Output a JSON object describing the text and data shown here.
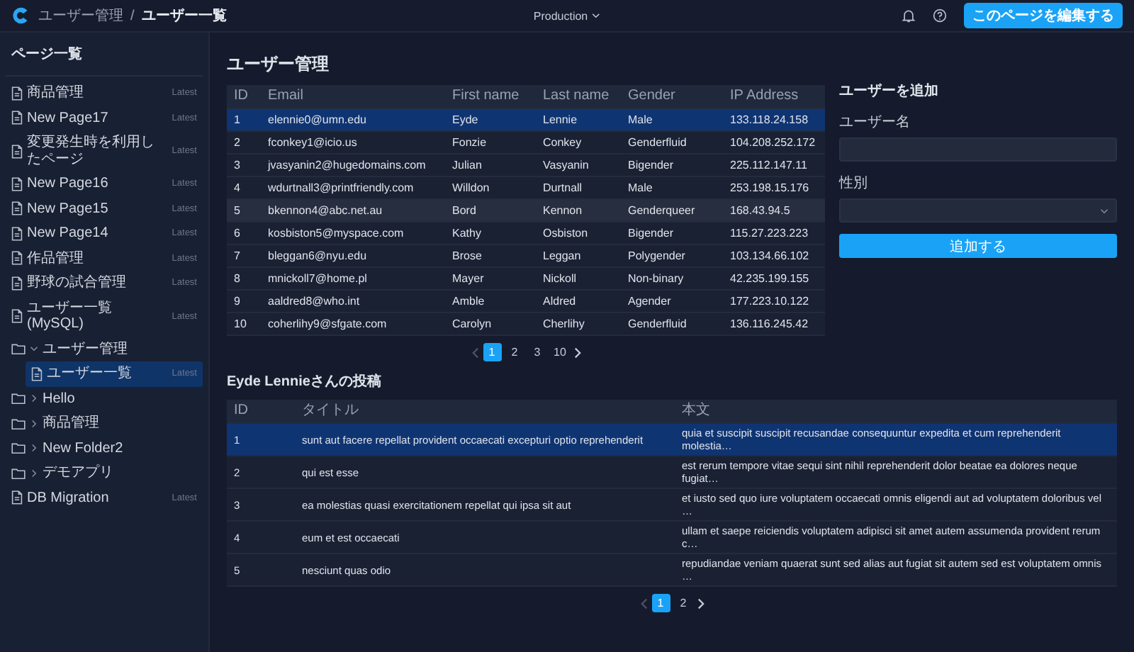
{
  "topbar": {
    "breadcrumb": [
      "ユーザー管理",
      "ユーザー一覧"
    ],
    "separator": "/",
    "environment": "Production",
    "edit_button": "このページを編集する"
  },
  "sidebar": {
    "title": "ページ一覧",
    "items": [
      {
        "kind": "page",
        "label": "商品管理",
        "badge": "Latest",
        "selected": false
      },
      {
        "kind": "page",
        "label": "New Page17",
        "badge": "Latest",
        "selected": false
      },
      {
        "kind": "page",
        "label": "変更発生時を利用したページ",
        "badge": "Latest",
        "selected": false
      },
      {
        "kind": "page",
        "label": "New Page16",
        "badge": "Latest",
        "selected": false
      },
      {
        "kind": "page",
        "label": "New Page15",
        "badge": "Latest",
        "selected": false
      },
      {
        "kind": "page",
        "label": "New Page14",
        "badge": "Latest",
        "selected": false
      },
      {
        "kind": "page",
        "label": "作品管理",
        "badge": "Latest",
        "selected": false
      },
      {
        "kind": "page",
        "label": "野球の試合管理",
        "badge": "Latest",
        "selected": false
      },
      {
        "kind": "page",
        "label": "ユーザー一覧(MySQL)",
        "badge": "Latest",
        "selected": false
      },
      {
        "kind": "folder",
        "label": "ユーザー管理",
        "expanded": true,
        "children": [
          {
            "kind": "page",
            "label": "ユーザー一覧",
            "badge": "Latest",
            "selected": true
          }
        ]
      },
      {
        "kind": "folder",
        "label": "Hello",
        "expanded": false
      },
      {
        "kind": "folder",
        "label": "商品管理",
        "expanded": false
      },
      {
        "kind": "folder",
        "label": "New Folder2",
        "expanded": false
      },
      {
        "kind": "folder",
        "label": "デモアプリ",
        "expanded": false
      },
      {
        "kind": "page",
        "label": "DB Migration",
        "badge": "Latest",
        "selected": false
      }
    ]
  },
  "users": {
    "title": "ユーザー管理",
    "table": {
      "columns": [
        "ID",
        "Email",
        "First name",
        "Last name",
        "Gender",
        "IP Address"
      ],
      "rows": [
        {
          "cells": [
            "1",
            "elennie0@umn.edu",
            "Eyde",
            "Lennie",
            "Male",
            "133.118.24.158"
          ],
          "selected": true,
          "hovered": false
        },
        {
          "cells": [
            "2",
            "fconkey1@icio.us",
            "Fonzie",
            "Conkey",
            "Genderfluid",
            "104.208.252.172"
          ],
          "selected": false,
          "hovered": false
        },
        {
          "cells": [
            "3",
            "jvasyanin2@hugedomains.com",
            "Julian",
            "Vasyanin",
            "Bigender",
            "225.112.147.11"
          ],
          "selected": false,
          "hovered": false
        },
        {
          "cells": [
            "4",
            "wdurtnall3@printfriendly.com",
            "Willdon",
            "Durtnall",
            "Male",
            "253.198.15.176"
          ],
          "selected": false,
          "hovered": false
        },
        {
          "cells": [
            "5",
            "bkennon4@abc.net.au",
            "Bord",
            "Kennon",
            "Genderqueer",
            "168.43.94.5"
          ],
          "selected": false,
          "hovered": true
        },
        {
          "cells": [
            "6",
            "kosbiston5@myspace.com",
            "Kathy",
            "Osbiston",
            "Bigender",
            "115.27.223.223"
          ],
          "selected": false,
          "hovered": false
        },
        {
          "cells": [
            "7",
            "bleggan6@nyu.edu",
            "Brose",
            "Leggan",
            "Polygender",
            "103.134.66.102"
          ],
          "selected": false,
          "hovered": false
        },
        {
          "cells": [
            "8",
            "mnickoll7@home.pl",
            "Mayer",
            "Nickoll",
            "Non-binary",
            "42.235.199.155"
          ],
          "selected": false,
          "hovered": false
        },
        {
          "cells": [
            "9",
            "aaldred8@who.int",
            "Amble",
            "Aldred",
            "Agender",
            "177.223.10.122"
          ],
          "selected": false,
          "hovered": false
        },
        {
          "cells": [
            "10",
            "coherlihy9@sfgate.com",
            "Carolyn",
            "Cherlihy",
            "Genderfluid",
            "136.116.245.42"
          ],
          "selected": false,
          "hovered": false
        }
      ]
    },
    "pagination": {
      "prev_disabled": true,
      "pages": [
        {
          "label": "1",
          "selected": true
        },
        {
          "label": "2",
          "selected": false
        },
        {
          "label": "3",
          "selected": false
        },
        {
          "label": "10",
          "selected": false
        }
      ]
    }
  },
  "form": {
    "title": "ユーザーを追加",
    "fields": [
      {
        "kind": "text",
        "label": "ユーザー名"
      },
      {
        "kind": "select",
        "label": "性別"
      }
    ],
    "submit": "追加する"
  },
  "posts": {
    "title": "Eyde Lennieさんの投稿",
    "table": {
      "columns": [
        "ID",
        "タイトル",
        "本文"
      ],
      "rows": [
        {
          "cells": [
            "1",
            "sunt aut facere repellat provident occaecati excepturi optio reprehenderit",
            "quia et suscipit suscipit recusandae consequuntur expedita et cum reprehenderit molestia…"
          ],
          "selected": true
        },
        {
          "cells": [
            "2",
            "qui est esse",
            "est rerum tempore vitae sequi sint nihil reprehenderit dolor beatae ea dolores neque fugiat…"
          ],
          "selected": false
        },
        {
          "cells": [
            "3",
            "ea molestias quasi exercitationem repellat qui ipsa sit aut",
            "et iusto sed quo iure voluptatem occaecati omnis eligendi aut ad voluptatem doloribus vel …"
          ],
          "selected": false
        },
        {
          "cells": [
            "4",
            "eum et est occaecati",
            "ullam et saepe reiciendis voluptatem adipisci sit amet autem assumenda provident rerum c…"
          ],
          "selected": false
        },
        {
          "cells": [
            "5",
            "nesciunt quas odio",
            "repudiandae veniam quaerat sunt sed alias aut fugiat sit autem sed est voluptatem omnis …"
          ],
          "selected": false
        }
      ]
    },
    "pagination": {
      "prev_disabled": true,
      "pages": [
        {
          "label": "1",
          "selected": true
        },
        {
          "label": "2",
          "selected": false
        }
      ]
    }
  }
}
